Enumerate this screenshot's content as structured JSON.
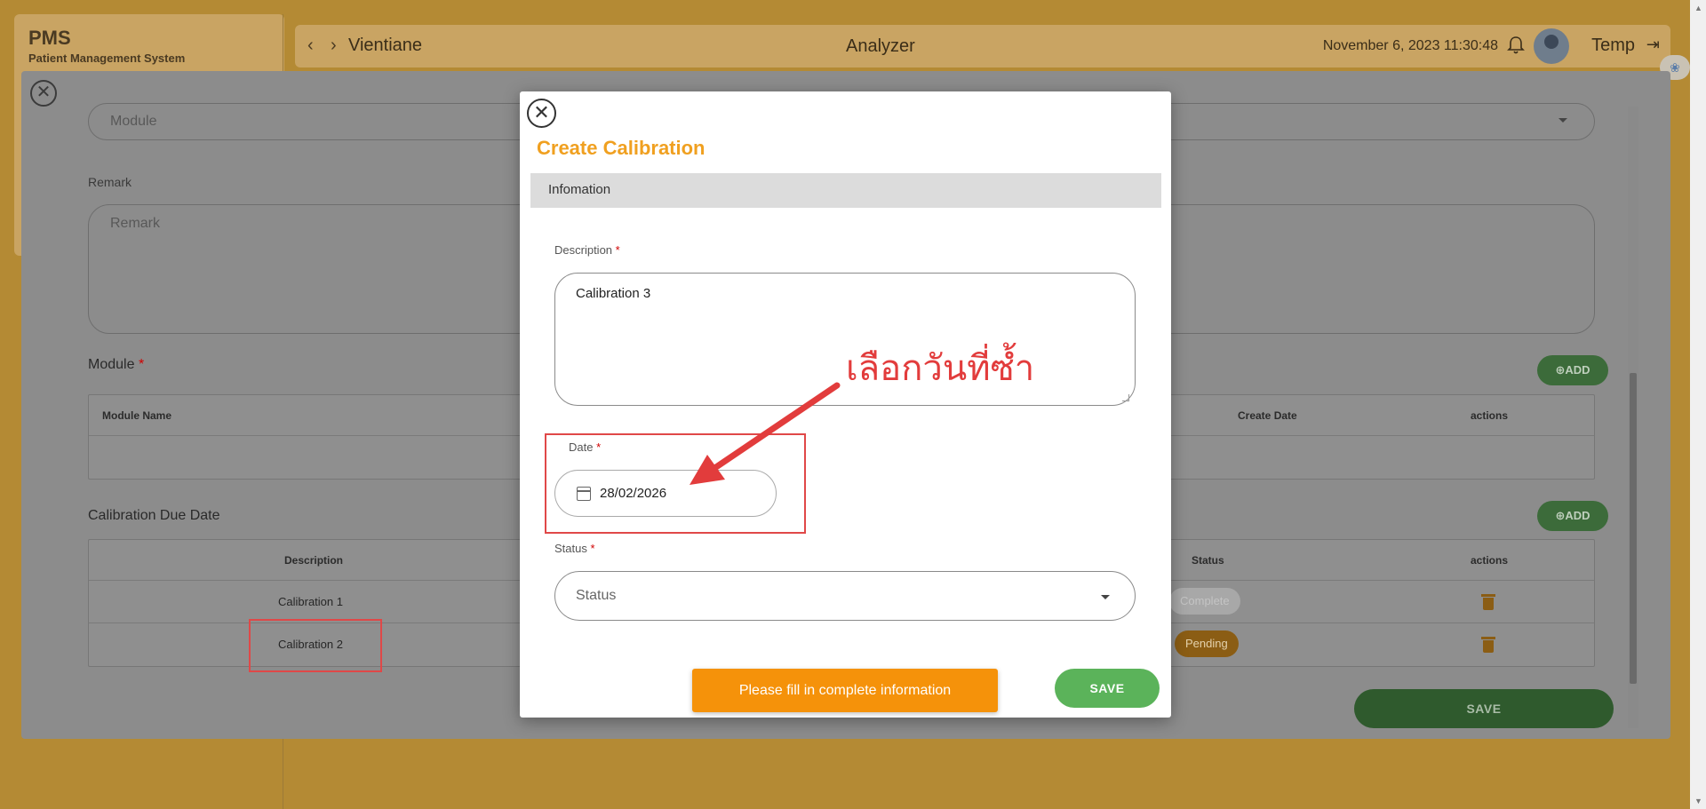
{
  "app": {
    "brand": "PMS",
    "brand_sub": "Patient Management System",
    "location": "Vientiane",
    "page_title": "Analyzer",
    "datetime": "November 6, 2023 11:30:48",
    "user_name": "Temp"
  },
  "main_dialog": {
    "module_select_placeholder": "Module",
    "remark_label": "Remark",
    "remark_placeholder": "Remark",
    "module_section": "Module",
    "add_label": "ADD",
    "module_table": {
      "columns": [
        "Module Name",
        "Create Date",
        "actions"
      ],
      "rows": []
    },
    "calibration_section": "Calibration Due Date",
    "calibration_table": {
      "columns": [
        "Description",
        "Status",
        "actions"
      ],
      "rows": [
        {
          "description": "Calibration 1",
          "status": "Complete"
        },
        {
          "description": "Calibration 2",
          "status": "Pending"
        }
      ]
    },
    "save_label": "SAVE"
  },
  "modal": {
    "title": "Create Calibration",
    "section_title": "Infomation",
    "description_label": "Description",
    "description_value": "Calibration 3",
    "date_label": "Date",
    "date_value": "28/02/2026",
    "status_label": "Status",
    "status_placeholder": "Status",
    "warning": "Please fill in complete information",
    "save_label": "SAVE"
  },
  "annotation": {
    "text": "เลือกวันที่ซ้ำ"
  },
  "colors": {
    "title": "#f0a020",
    "save_green": "#5bb35a",
    "warning_orange": "#f5920a",
    "highlight_red": "#e04848",
    "pending": "#8b5d14"
  }
}
